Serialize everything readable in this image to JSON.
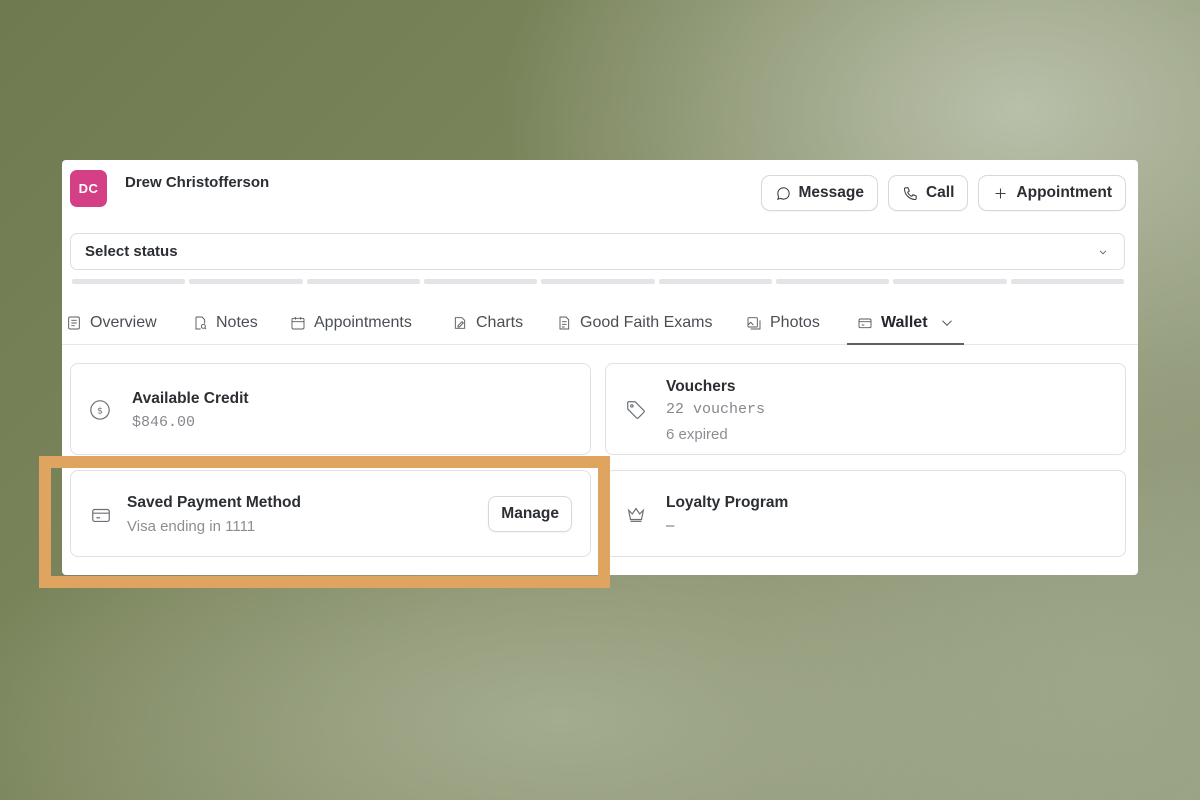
{
  "client": {
    "initials": "DC",
    "name": "Drew Christofferson",
    "avatar_color": "#d43f86"
  },
  "actions": {
    "message_label": "Message",
    "call_label": "Call",
    "appointment_label": "Appointment"
  },
  "status_select": {
    "selected": "Select status"
  },
  "progress": {
    "segments": 9,
    "completed": 0
  },
  "tabs": [
    {
      "label": "Overview",
      "icon": "overview-icon"
    },
    {
      "label": "Notes",
      "icon": "notes-icon"
    },
    {
      "label": "Appointments",
      "icon": "calendar-icon"
    },
    {
      "label": "Charts",
      "icon": "chart-icon"
    },
    {
      "label": "Good Faith Exams",
      "icon": "document-icon"
    },
    {
      "label": "Photos",
      "icon": "photos-icon"
    },
    {
      "label": "Wallet",
      "icon": "wallet-icon",
      "active": true
    }
  ],
  "wallet": {
    "available_credit": {
      "title": "Available Credit",
      "value": "$846.00"
    },
    "vouchers": {
      "title": "Vouchers",
      "count_text": "22 vouchers",
      "expired_text": "6 expired"
    },
    "saved_payment": {
      "title": "Saved Payment Method",
      "detail": "Visa ending in 1111",
      "button_label": "Manage"
    },
    "loyalty": {
      "title": "Loyalty Program",
      "value": "–"
    }
  },
  "highlight_color": "#dfa45f"
}
